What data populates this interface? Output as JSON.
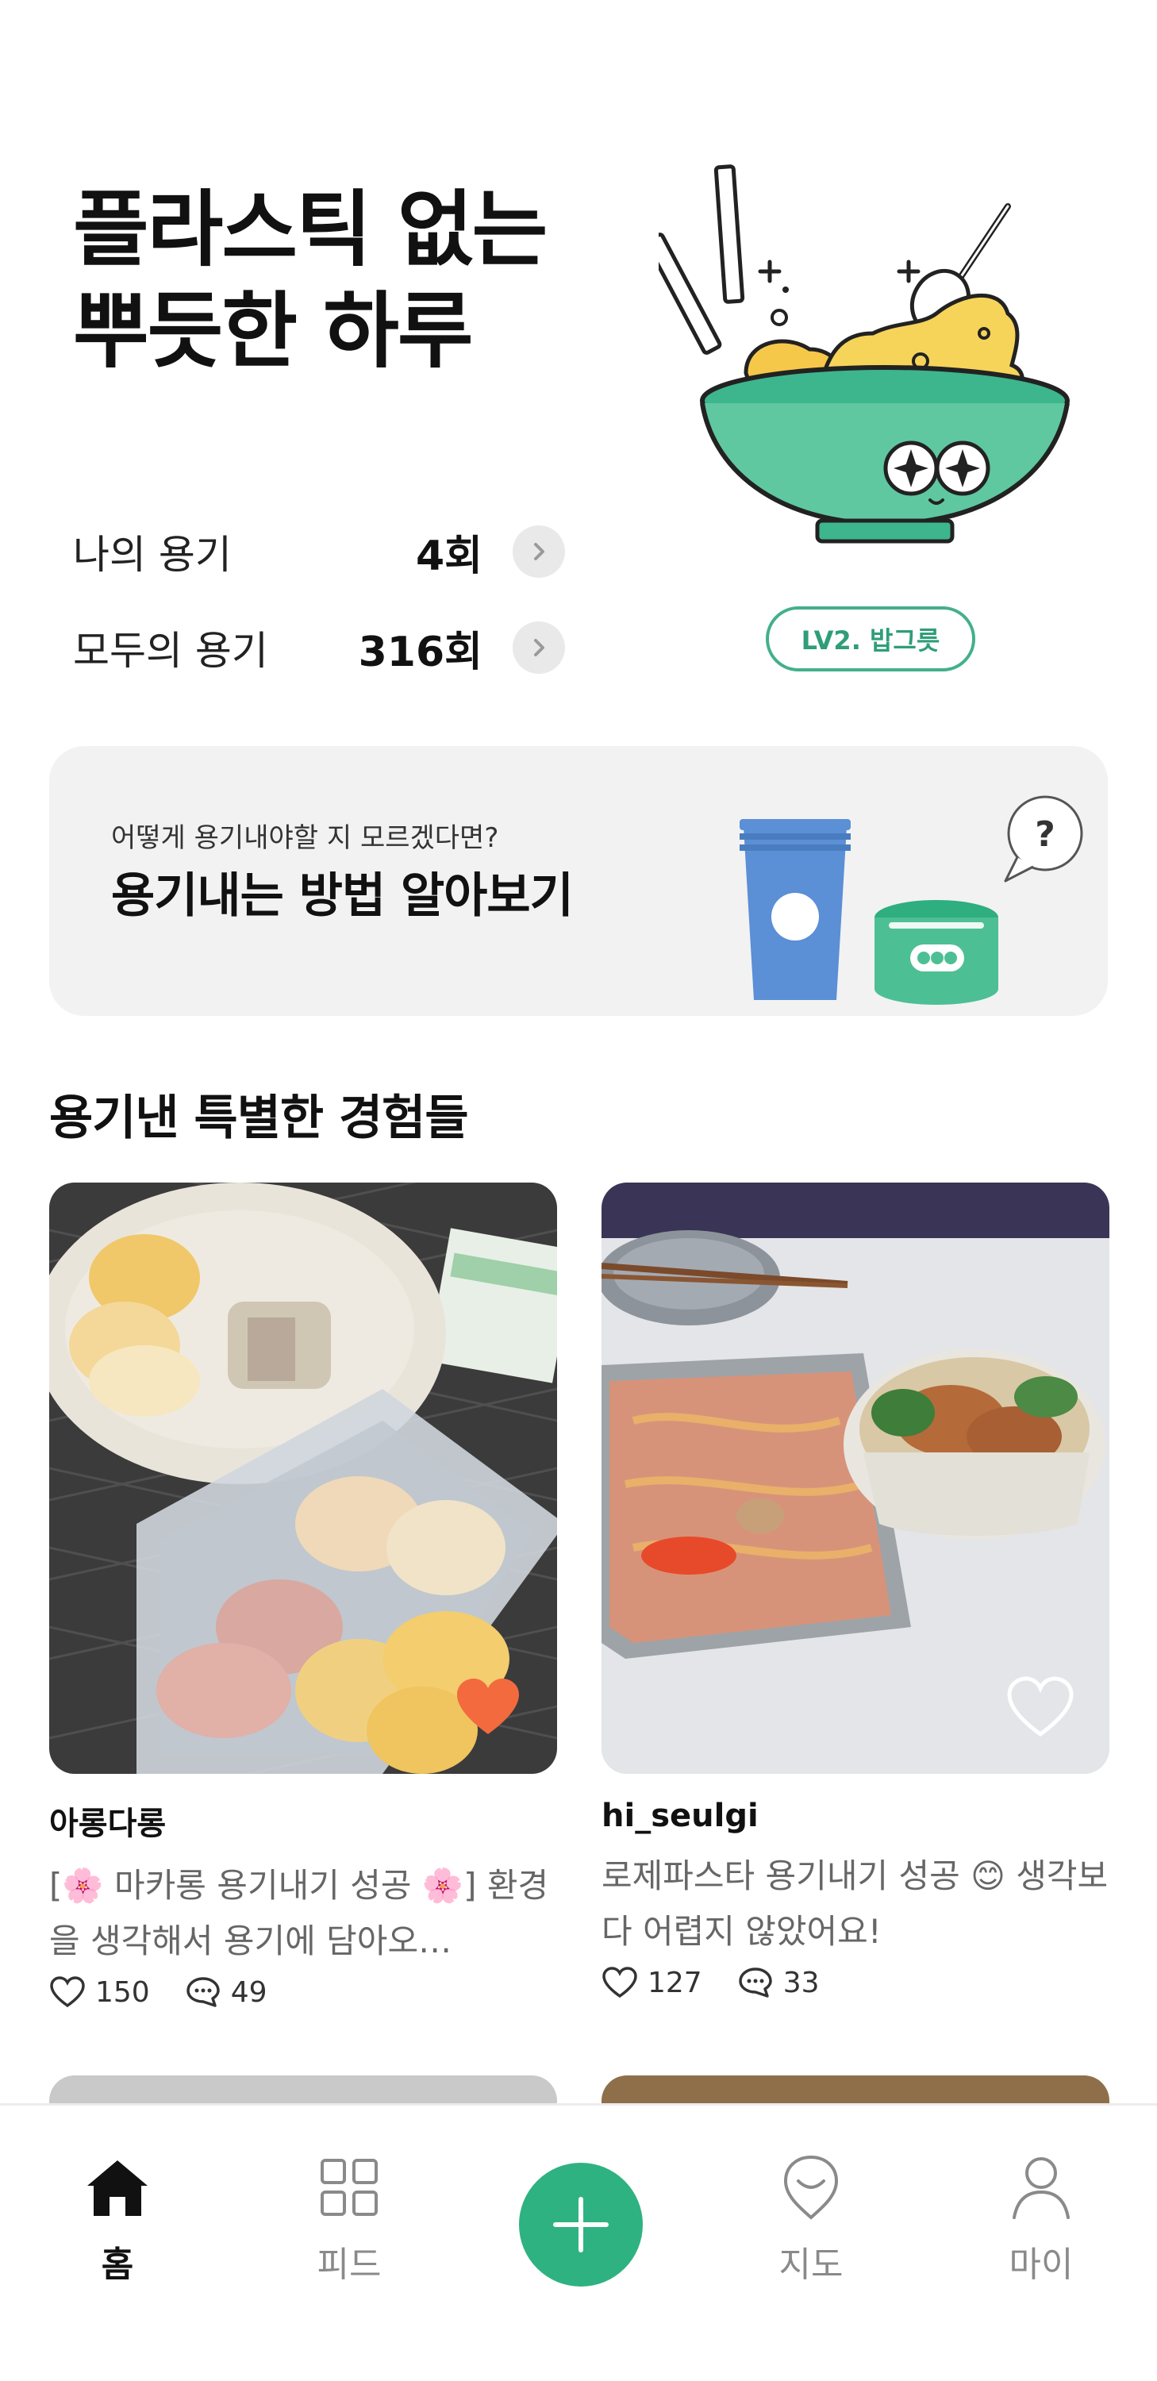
{
  "hero": {
    "title_line1": "플라스틱 없는",
    "title_line2": "뿌듯한 하루",
    "level_badge": "LV2. 밥그릇"
  },
  "stats": [
    {
      "label": "나의 용기",
      "value": "4회"
    },
    {
      "label": "모두의 용기",
      "value": "316회"
    }
  ],
  "guide": {
    "subtitle": "어떻게 용기내야할 지 모르겠다면?",
    "title": "용기내는 방법 알아보기"
  },
  "section": {
    "title": "용기낸 특별한 경험들"
  },
  "posts": [
    {
      "author": "아롱다롱",
      "description": "[🌸 마카롱 용기내기 성공 🌸] 환경을 생각해서 용기에 담아오…",
      "likes": "150",
      "comments": "49",
      "liked": true
    },
    {
      "author": "hi_seulgi",
      "description": "로제파스타 용기내기 성공 😊 생각보다 어렵지 않았어요!",
      "likes": "127",
      "comments": "33",
      "liked": false
    }
  ],
  "nav": {
    "home": "홈",
    "feed": "피드",
    "map": "지도",
    "my": "마이"
  },
  "colors": {
    "brand_green": "#2fb281",
    "banner_bg": "#f2f2f3",
    "like_orange": "#f26a3d"
  }
}
